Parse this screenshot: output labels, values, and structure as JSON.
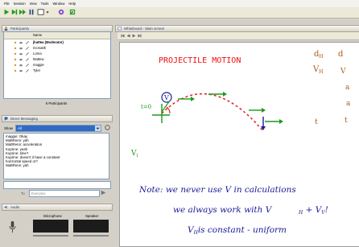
{
  "menu": [
    "File",
    "Session",
    "View",
    "Tools",
    "Window",
    "Help"
  ],
  "participants": {
    "title": "Participants",
    "column_name": "Name",
    "list": [
      {
        "name": "jhattea (Moderator)",
        "bold": true
      },
      {
        "name": "mcmatth",
        "bold": false
      },
      {
        "name": "Lorna",
        "bold": false
      },
      {
        "name": "Mattew",
        "bold": false
      },
      {
        "name": "maggie",
        "bold": false
      },
      {
        "name": "Tyler",
        "bold": false
      }
    ],
    "count_label": "6 Participants"
  },
  "messaging": {
    "title": "Direct Messaging",
    "show_label": "Show",
    "show_value": "All",
    "messages": [
      "maggie: Okay",
      "MattRenn: yah",
      "MattRenn: acceleration",
      "Koprine: yeah",
      "Koprine: time?",
      "Koprine: doesn't it have a constant",
      "horizontal speed or?",
      "MattRenn: yah"
    ],
    "to_label": "To",
    "to_value": "Everyone"
  },
  "audio": {
    "title": "Audio",
    "microphone_label": "Microphone",
    "speaker_label": "Speaker"
  },
  "whiteboard": {
    "tab_title": "Whiteboard - Main screen",
    "heading": "PROJECTILE   MOTION",
    "note_line1": "Note:  we never use V in calculations",
    "note_line2": "we always work with  V",
    "note_line3": "V",
    "note_line3_rest": "is constant  -  uniform",
    "label_vi": "V",
    "label_t": "t=0",
    "colors": {
      "heading": "#ee1111",
      "note": "#1a1a99",
      "arrow": "#1a9a1a",
      "path": "#e02020",
      "margin": "#b05a10"
    }
  }
}
